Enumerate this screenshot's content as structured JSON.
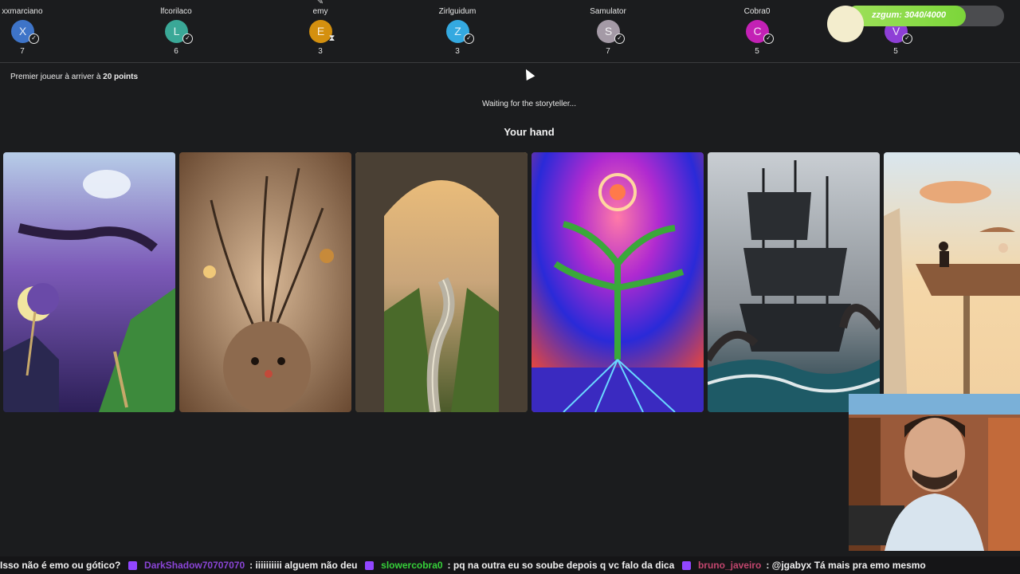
{
  "players": [
    {
      "name": "xxmarciano",
      "initial": "X",
      "score": "7",
      "color": "#3e74c8",
      "status": "check-icon"
    },
    {
      "name": "lfcorilaco",
      "initial": "L",
      "score": "6",
      "color": "#3aa897",
      "status": "check-icon"
    },
    {
      "name": "emy",
      "initial": "E",
      "score": "3",
      "color": "#d4900f",
      "status": "hourglass-icon",
      "storyteller": true
    },
    {
      "name": "Zirlguidum",
      "initial": "Z",
      "score": "3",
      "color": "#34a9e0",
      "status": "check-icon"
    },
    {
      "name": "Samulator",
      "initial": "S",
      "score": "7",
      "color": "#a49aa6",
      "status": "check-icon"
    },
    {
      "name": "Cobra0",
      "initial": "C",
      "score": "5",
      "color": "#c321b5",
      "status": "check-icon"
    },
    {
      "name": "",
      "initial": "V",
      "score": "5",
      "color": "#8e3fd6",
      "status": "check-icon"
    }
  ],
  "xp": {
    "label": "zzgum: 3040/4000",
    "progress": 0.76
  },
  "goal": {
    "prefix": "Premier joueur à arriver à ",
    "points": "20 points"
  },
  "status_text": "Waiting for the storyteller...",
  "hand_title": "Your hand",
  "cards": [
    {
      "name": "card-dreamer-moon"
    },
    {
      "name": "card-tangled-creature"
    },
    {
      "name": "card-stone-arch-road"
    },
    {
      "name": "card-cosmic-tree"
    },
    {
      "name": "card-pirate-ship-kraken"
    },
    {
      "name": "card-couple-on-boat"
    }
  ],
  "chat": [
    {
      "user": "",
      "text": "Isso não é emo ou gótico?"
    },
    {
      "user": "DarkShadow70707070",
      "text": ": iiiiiiiiii alguem não deu"
    },
    {
      "user": "slowercobra0",
      "text": ": pq na outra eu so soube depois q vc falo da dica"
    },
    {
      "user": "bruno_javeiro",
      "text": ": @jgabyx Tá mais pra emo mesmo"
    }
  ]
}
